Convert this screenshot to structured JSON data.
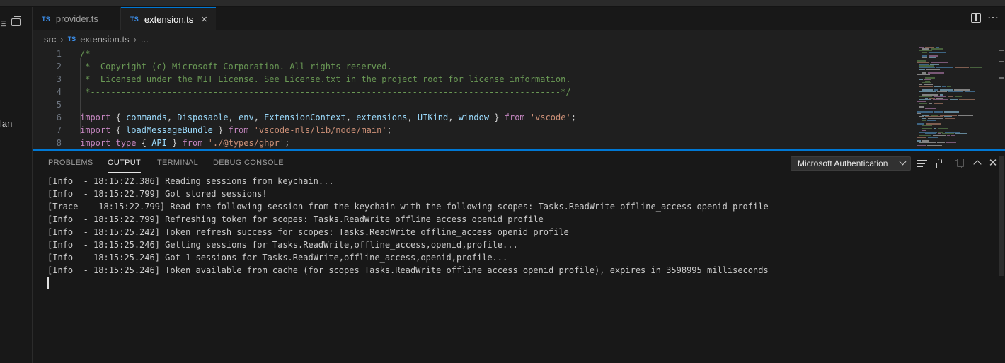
{
  "sidebar": {
    "clipped_label": "lan"
  },
  "tabs": [
    {
      "lang": "TS",
      "label": "provider.ts",
      "active": false
    },
    {
      "lang": "TS",
      "label": "extension.ts",
      "active": true,
      "close": "×"
    }
  ],
  "breadcrumb": {
    "folder": "src",
    "lang": "TS",
    "file": "extension.ts",
    "tail": "..."
  },
  "editor": {
    "lines": [
      {
        "n": "1",
        "tokens": [
          {
            "t": "/*---------------------------------------------------------------------------------------------",
            "c": "c-comment"
          }
        ]
      },
      {
        "n": "2",
        "tokens": [
          {
            "t": " *  Copyright (c) Microsoft Corporation. All rights reserved.",
            "c": "c-comment"
          }
        ]
      },
      {
        "n": "3",
        "tokens": [
          {
            "t": " *  Licensed under the MIT License. See License.txt in the project root for license information.",
            "c": "c-comment"
          }
        ]
      },
      {
        "n": "4",
        "tokens": [
          {
            "t": " *--------------------------------------------------------------------------------------------*/",
            "c": "c-comment"
          }
        ]
      },
      {
        "n": "5",
        "tokens": []
      },
      {
        "n": "6",
        "tokens": [
          {
            "t": "import",
            "c": "c-key"
          },
          {
            "t": " { ",
            "c": "c-plain"
          },
          {
            "t": "commands",
            "c": "c-var"
          },
          {
            "t": ", ",
            "c": "c-plain"
          },
          {
            "t": "Disposable",
            "c": "c-var"
          },
          {
            "t": ", ",
            "c": "c-plain"
          },
          {
            "t": "env",
            "c": "c-var"
          },
          {
            "t": ", ",
            "c": "c-plain"
          },
          {
            "t": "ExtensionContext",
            "c": "c-var"
          },
          {
            "t": ", ",
            "c": "c-plain"
          },
          {
            "t": "extensions",
            "c": "c-var"
          },
          {
            "t": ", ",
            "c": "c-plain"
          },
          {
            "t": "UIKind",
            "c": "c-var"
          },
          {
            "t": ", ",
            "c": "c-plain"
          },
          {
            "t": "window",
            "c": "c-var"
          },
          {
            "t": " } ",
            "c": "c-plain"
          },
          {
            "t": "from",
            "c": "c-key"
          },
          {
            "t": " ",
            "c": "c-plain"
          },
          {
            "t": "'vscode'",
            "c": "c-str"
          },
          {
            "t": ";",
            "c": "c-plain"
          }
        ]
      },
      {
        "n": "7",
        "tokens": [
          {
            "t": "import",
            "c": "c-key"
          },
          {
            "t": " { ",
            "c": "c-plain"
          },
          {
            "t": "loadMessageBundle",
            "c": "c-var"
          },
          {
            "t": " } ",
            "c": "c-plain"
          },
          {
            "t": "from",
            "c": "c-key"
          },
          {
            "t": " ",
            "c": "c-plain"
          },
          {
            "t": "'vscode-nls/lib/node/main'",
            "c": "c-str"
          },
          {
            "t": ";",
            "c": "c-plain"
          }
        ]
      },
      {
        "n": "8",
        "tokens": [
          {
            "t": "import",
            "c": "c-key"
          },
          {
            "t": " ",
            "c": "c-plain"
          },
          {
            "t": "type",
            "c": "c-key"
          },
          {
            "t": " { ",
            "c": "c-plain"
          },
          {
            "t": "API",
            "c": "c-var"
          },
          {
            "t": " } ",
            "c": "c-plain"
          },
          {
            "t": "from",
            "c": "c-key"
          },
          {
            "t": " ",
            "c": "c-plain"
          },
          {
            "t": "'./@types/ghpr'",
            "c": "c-str"
          },
          {
            "t": ";",
            "c": "c-plain"
          }
        ]
      }
    ]
  },
  "panel": {
    "tabs": [
      "PROBLEMS",
      "OUTPUT",
      "TERMINAL",
      "DEBUG CONSOLE"
    ],
    "active_tab": "OUTPUT",
    "channel": "Microsoft Authentication",
    "close_glyph": "✕",
    "output_lines": [
      "[Info  - 18:15:22.386] Reading sessions from keychain...",
      "[Info  - 18:15:22.799] Got stored sessions!",
      "[Trace  - 18:15:22.799] Read the following session from the keychain with the following scopes: Tasks.ReadWrite offline_access openid profile",
      "[Info  - 18:15:22.799] Refreshing token for scopes: Tasks.ReadWrite offline_access openid profile",
      "[Info  - 18:15:25.242] Token refresh success for scopes: Tasks.ReadWrite offline_access openid profile",
      "[Info  - 18:15:25.246] Getting sessions for Tasks.ReadWrite,offline_access,openid,profile...",
      "[Info  - 18:15:25.246] Got 1 sessions for Tasks.ReadWrite,offline_access,openid,profile...",
      "[Info  - 18:15:25.246] Token available from cache (for scopes Tasks.ReadWrite offline_access openid profile), expires in 3598995 milliseconds"
    ]
  },
  "colors": {
    "accent": "#0078d4",
    "ts_icon": "#3b8eea"
  }
}
